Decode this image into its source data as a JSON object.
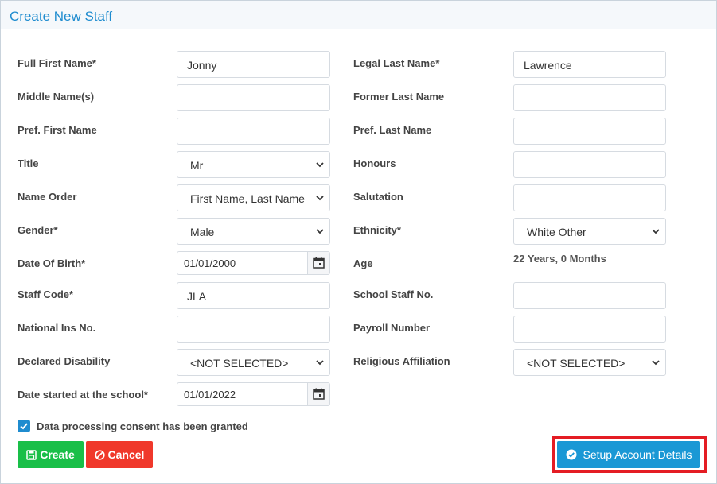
{
  "title": "Create New Staff",
  "left": {
    "first_name": {
      "label": "Full First Name*",
      "value": "Jonny"
    },
    "middle_name": {
      "label": "Middle Name(s)",
      "value": ""
    },
    "pref_first": {
      "label": "Pref. First Name",
      "value": ""
    },
    "title": {
      "label": "Title",
      "value": "Mr"
    },
    "name_order": {
      "label": "Name Order",
      "value": "First Name, Last Name"
    },
    "gender": {
      "label": "Gender*",
      "value": "Male"
    },
    "dob": {
      "label": "Date Of Birth*",
      "value": "01/01/2000"
    },
    "staff_code": {
      "label": "Staff Code*",
      "value": "JLA"
    },
    "ni_no": {
      "label": "National Ins No.",
      "value": ""
    },
    "disability": {
      "label": "Declared Disability",
      "value": "<NOT SELECTED>"
    },
    "date_started": {
      "label": "Date started at the school*",
      "value": "01/01/2022"
    }
  },
  "right": {
    "legal_last": {
      "label": "Legal Last Name*",
      "value": "Lawrence"
    },
    "former_last": {
      "label": "Former Last Name",
      "value": ""
    },
    "pref_last": {
      "label": "Pref. Last Name",
      "value": ""
    },
    "honours": {
      "label": "Honours",
      "value": ""
    },
    "salutation": {
      "label": "Salutation",
      "value": ""
    },
    "ethnicity": {
      "label": "Ethnicity*",
      "value": "White Other"
    },
    "age": {
      "label": "Age",
      "value": "22 Years, 0 Months"
    },
    "school_staff_no": {
      "label": "School Staff No.",
      "value": ""
    },
    "payroll": {
      "label": "Payroll Number",
      "value": ""
    },
    "religion": {
      "label": "Religious Affiliation",
      "value": "<NOT SELECTED>"
    }
  },
  "consent": {
    "label": "Data processing consent has been granted",
    "checked": true
  },
  "buttons": {
    "create": "Create",
    "cancel": "Cancel",
    "setup": "Setup Account Details"
  },
  "colors": {
    "accent": "#1f8ccf",
    "create": "#19bf48",
    "cancel": "#f0382b",
    "setup": "#1a98d5",
    "highlight": "#e41c23"
  },
  "icons": {
    "create": "save-icon",
    "cancel": "cancel-circle-icon",
    "setup": "check-circle-icon",
    "date": "calendar-icon",
    "select": "chevron-down-icon"
  }
}
